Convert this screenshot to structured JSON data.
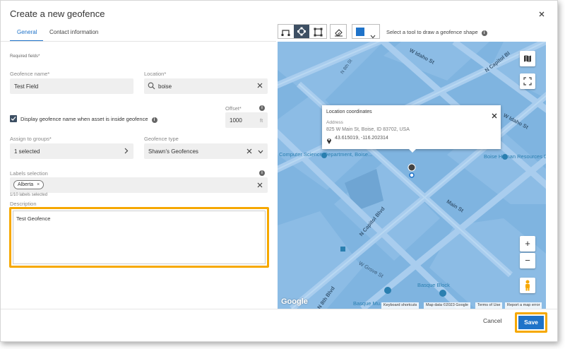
{
  "dialog": {
    "title": "Create a new geofence",
    "close_icon": "close-icon"
  },
  "tabs": [
    {
      "label": "General",
      "active": true
    },
    {
      "label": "Contact information",
      "active": false
    }
  ],
  "form": {
    "required_note": "Required fields*",
    "geofence_name": {
      "label": "Geofence name*",
      "value": "Test Field"
    },
    "location": {
      "label": "Location*",
      "value": "boise",
      "icon": "search-icon"
    },
    "offset": {
      "label": "Offset*",
      "value": "1000",
      "unit": "ft"
    },
    "display_name_checkbox": {
      "label": "Display geofence name when asset is inside geofence",
      "checked": true
    },
    "assign_to_groups": {
      "label": "Assign to groups*",
      "value": "1 selected"
    },
    "geofence_type": {
      "label": "Geofence type",
      "value": "Shawn's Geofences"
    },
    "labels_selection": {
      "label": "Labels selection",
      "chips": [
        "Alberta"
      ],
      "count_note": "1/10 labels selected"
    },
    "description": {
      "label": "Description",
      "value": "Test Geofence"
    }
  },
  "toolbar": {
    "tool_hint": "Select a tool to draw a geofence shape",
    "color_swatch": "#1f73c9"
  },
  "map": {
    "streets": [
      "W Idaho St",
      "N Capitol Bl",
      "N 8th St",
      "W Idaho St",
      "Main St",
      "N Capitol Blvd",
      "W Grove St",
      "N 8th Blvd"
    ],
    "pois": [
      "Computer Science Department, Boise...",
      "Boise Human Resources Department",
      "Basque Block",
      "Basque Mu..."
    ],
    "popup": {
      "title": "Location coordinates",
      "address_label": "Address",
      "address": "825 W Main St, Boise, ID 83702, USA",
      "coordinates": "43.615019, -116.202314"
    },
    "attribution": [
      "Keyboard shortcuts",
      "Map data ©2023 Google",
      "Terms of Use",
      "Report a map error"
    ],
    "google_logo": "Google"
  },
  "footer": {
    "cancel_label": "Cancel",
    "save_label": "Save"
  },
  "colors": {
    "accent": "#1f73c9",
    "highlight": "#f6a800",
    "map_water": "#7fb4e0"
  }
}
